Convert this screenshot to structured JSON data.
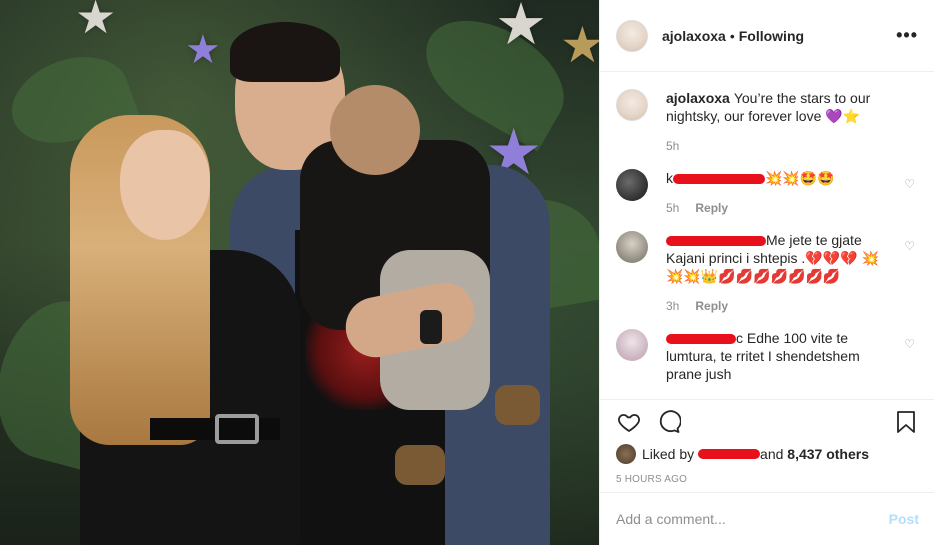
{
  "post": {
    "username": "ajolaxoxa",
    "follow_status": "Following",
    "more_icon": "more-horizontal-icon"
  },
  "caption": {
    "username": "ajolaxoxa",
    "text": "You’re the stars to our nightsky, our forever love 💜⭐",
    "time": "5h"
  },
  "comments": [
    {
      "text_visible": "k",
      "emojis": "💥💥🤩🤩",
      "time": "5h",
      "reply_label": "Reply"
    },
    {
      "text_visible": "Me jete te gjate Kajani princi i shtepis .💔💔💔 💥💥💥👑💋💋💋💋💋💋💋",
      "time": "3h",
      "reply_label": "Reply"
    },
    {
      "text_visible": "c Edhe 100 vite te lumtura, te rritet I shendetshem prane jush"
    }
  ],
  "actions": {
    "like_icon": "heart-icon",
    "comment_icon": "comment-icon",
    "save_icon": "bookmark-icon"
  },
  "likes": {
    "prefix": "Liked by",
    "and": "and",
    "count_text": "8,437 others"
  },
  "timestamp": "5 HOURS AGO",
  "add_comment": {
    "placeholder": "Add a comment...",
    "post_label": "Post"
  },
  "colors": {
    "redaction": "#e8101b",
    "post_disabled": "#b2dffc",
    "meta_gray": "#8e8e8e"
  }
}
